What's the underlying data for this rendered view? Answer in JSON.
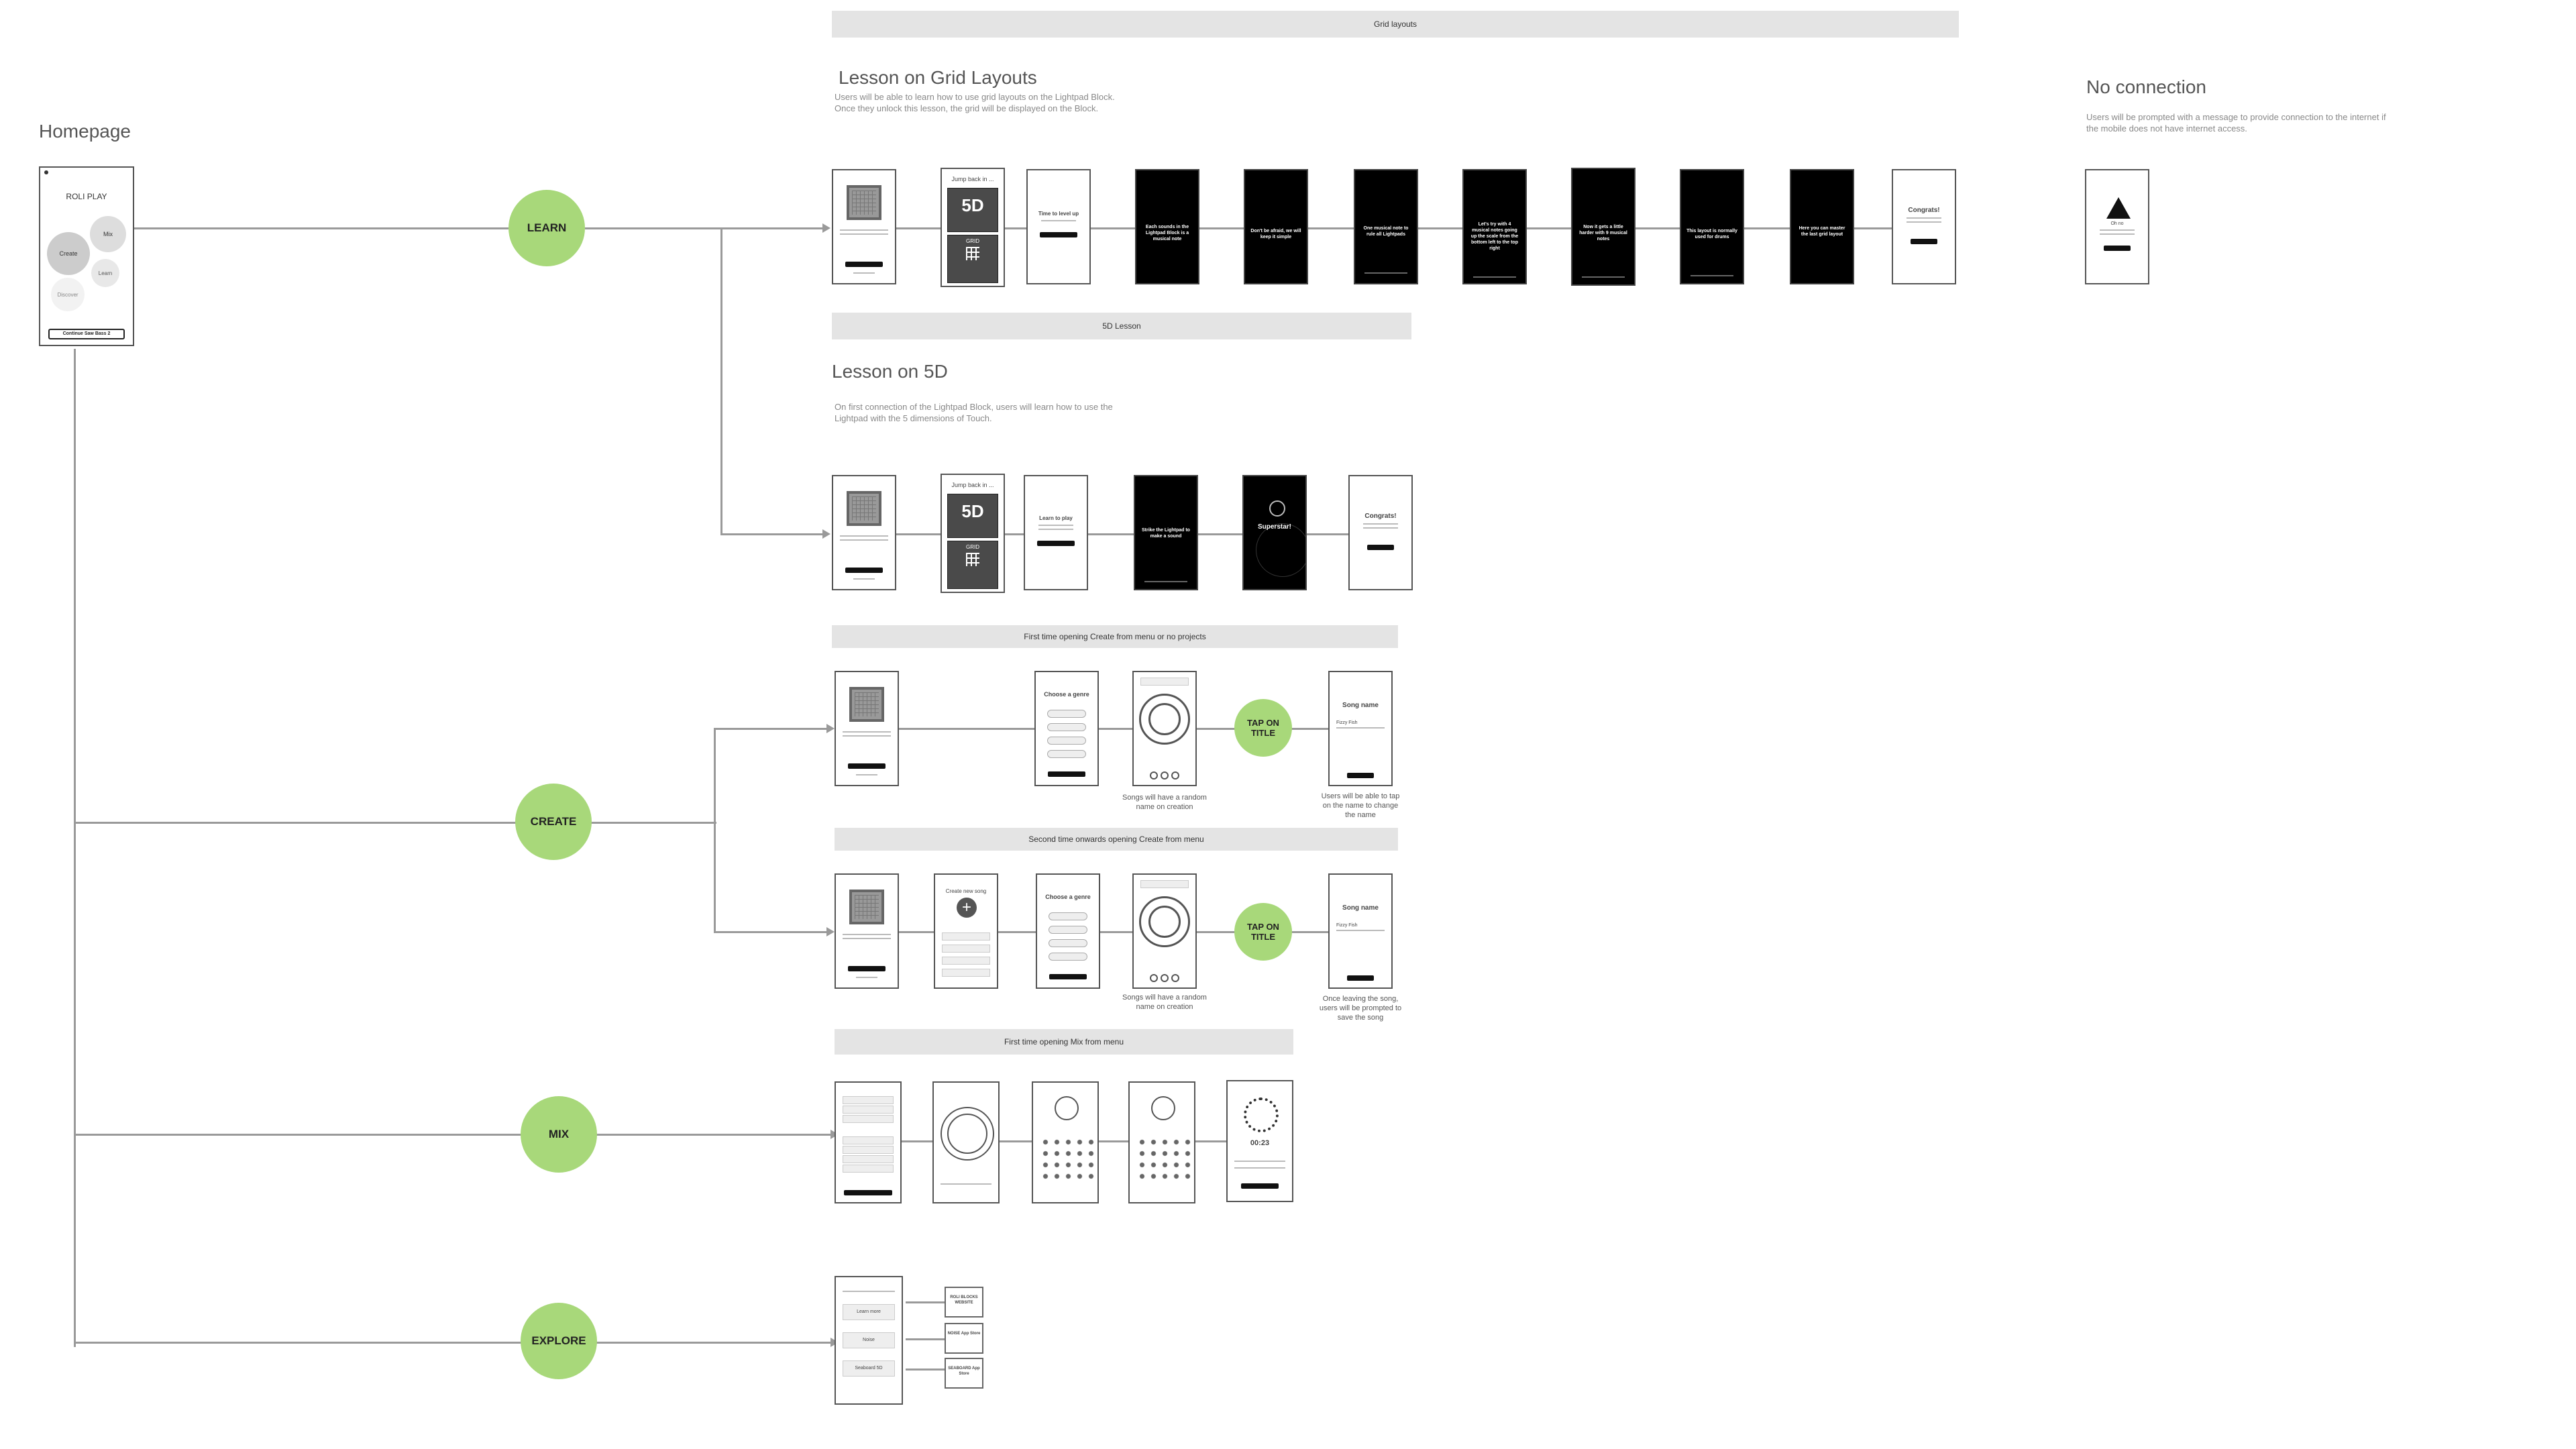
{
  "headings": {
    "homepage": "Homepage",
    "grid_lesson": "Lesson on Grid Layouts",
    "lesson_5d": "Lesson on 5D",
    "no_connection": "No connection"
  },
  "descriptions": {
    "grid_lesson": "Users will be able to learn how to use grid layouts on the Lightpad Block. Once they unlock this lesson, the grid will be displayed on the Block.",
    "lesson_5d": "On first connection of the Lightpad Block, users will learn how to use the Lightpad with the 5 dimensions of Touch.",
    "no_connection": "Users will be prompted with a message to provide connection to the internet if the mobile does not have internet access."
  },
  "banners": {
    "grid_layouts": "Grid layouts",
    "lesson_5d": "5D Lesson",
    "create_first": "First time opening Create from menu or no projects",
    "create_second": "Second time onwards opening Create from menu",
    "mix_first": "First time opening Mix from menu"
  },
  "nodes": {
    "learn": "LEARN",
    "create": "CREATE",
    "mix": "MIX",
    "explore": "EXPLORE",
    "tap_on_title": "TAP ON TITLE"
  },
  "homepage_screen": {
    "app_name": "ROLI PLAY",
    "create": "Create",
    "mix": "Mix",
    "learn": "Learn",
    "discover": "Discover",
    "continue": "Continue Saw Bass 2"
  },
  "screen_text": {
    "jump_back": "Jump back in ...",
    "tile_5d": "5D",
    "tile_grid": "GRID",
    "time_to_level_up": "Time to level up",
    "learn_to_play": "Learn to play",
    "superstar": "Superstar!",
    "congrats": "Congrats!",
    "choose_genre": "Choose a genre",
    "create_new_song": "Create new song",
    "song_name": "Song name",
    "song_name_value": "Fizzy Fish",
    "timer": "00:23",
    "oh_no": "Oh no"
  },
  "grid_lesson_screens": [
    "Each sounds in the Lightpad Block is a musical note",
    "Don't be afraid, we will keep it simple",
    "One musical note to rule all Lightpads",
    "Let's try with 4 musical notes going up the scale from the bottom left to the top right",
    "Now it gets a little harder with 9 musical notes",
    "This layout is normally used for drums",
    "Here you can master the last grid layout"
  ],
  "lesson_5d_screens": [
    "Strike the Lightpad to make a sound"
  ],
  "captions": {
    "random_name_1": "Songs will have a random name on creation",
    "tap_name": "Users will be able to tap on the name to change the name",
    "random_name_2": "Songs will have a random name on creation",
    "save_song": "Once leaving the song, users will be prompted to save the song"
  },
  "explore_cards": [
    "ROLI BLOCKS WEBSITE",
    "NOISE App Store",
    "SEABOARD App Store"
  ],
  "explore_rows": [
    "Learn more",
    "Noise",
    "Seaboard 5D"
  ]
}
